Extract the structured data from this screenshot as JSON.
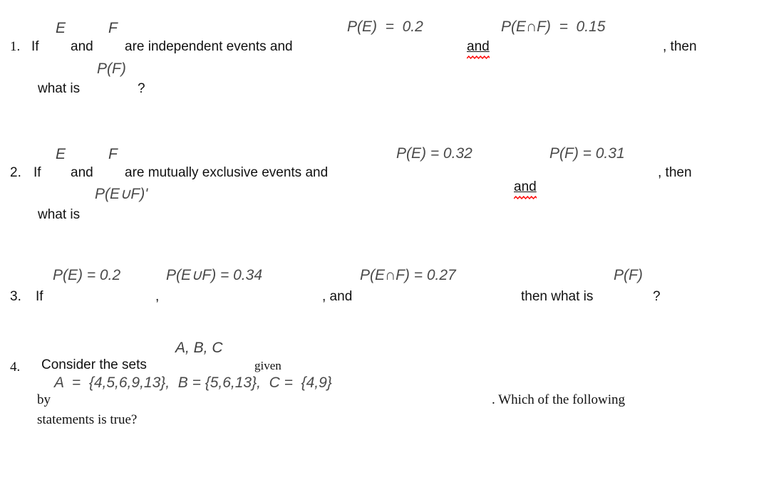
{
  "document": {
    "type": "math-worksheet",
    "background_color": "#ffffff",
    "text_color": "#111111",
    "equation_color": "#4a4a4a",
    "spellcheck_color": "#ff0000"
  },
  "questions": [
    {
      "number": "1.",
      "text_1": "If",
      "var_E": "E",
      "text_2": "and",
      "var_F": "F",
      "text_3": "are independent events and",
      "eq_1": "P(E)  =  0.2",
      "text_4": "and",
      "eq_2": "P(E∩F)  =  0.15",
      "text_5": ", then",
      "text_6": "what is",
      "eq_3": "P(F)",
      "text_7": "?",
      "misspelled_word": "and"
    },
    {
      "number": "2.",
      "text_1": "If",
      "var_E": "E",
      "text_2": "and",
      "var_F": "F",
      "text_3": "are mutually exclusive events and",
      "eq_1": "P(E) = 0.32",
      "text_4": "and",
      "eq_2": "P(F) = 0.31",
      "text_5": ", then",
      "text_6": "what is",
      "eq_3": "P(E∪F)'",
      "misspelled_word": "and"
    },
    {
      "number": "3.",
      "text_1": "If",
      "eq_1": "P(E) = 0.2",
      "eq_2": "P(E∪F) = 0.34",
      "text_2": ",",
      "text_3": ", and",
      "eq_3": "P(E∩F) = 0.27",
      "text_4": "then what is",
      "eq_4": "P(F)",
      "text_5": "?"
    },
    {
      "number": "4.",
      "text_1": "Consider the sets",
      "eq_sets": "A, B, C",
      "text_2": "given",
      "text_3": "by",
      "eq_definition": "A  =  {4,5,6,9,13},  B = {5,6,13},  C =  {4,9}",
      "text_4": ". Which of the following",
      "text_5": "statements is true?"
    }
  ]
}
